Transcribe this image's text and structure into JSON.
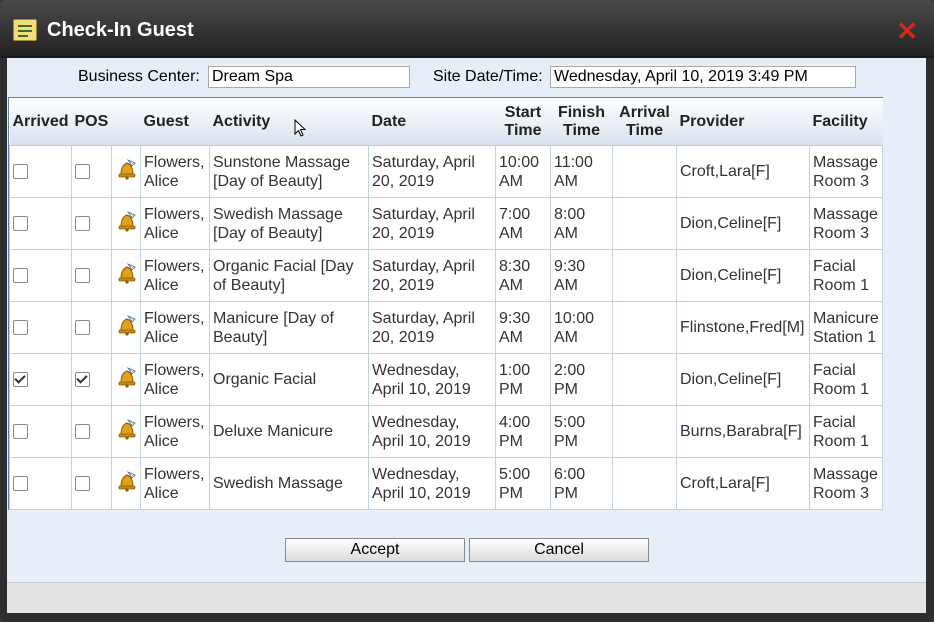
{
  "window": {
    "title": "Check-In Guest",
    "close_icon": "close-icon"
  },
  "form": {
    "business_center_label": "Business Center:",
    "business_center_value": "Dream Spa",
    "site_datetime_label": "Site Date/Time:",
    "site_datetime_value": "Wednesday, April 10, 2019 3:49 PM"
  },
  "table": {
    "headers": {
      "arrived": "Arrived",
      "pos": "POS",
      "guest": "Guest",
      "activity": "Activity",
      "date": "Date",
      "start_time": "Start Time",
      "finish_time": "Finish Time",
      "arrival_time": "Arrival Time",
      "provider": "Provider",
      "facility": "Facility"
    },
    "rows": [
      {
        "arrived": false,
        "pos": false,
        "guest": "Flowers, Alice",
        "activity": "Sunstone Massage [Day of Beauty]",
        "date": "Saturday, April 20, 2019",
        "start": "10:00 AM",
        "finish": "11:00 AM",
        "arrival": "",
        "provider": "Croft,Lara[F]",
        "facility": "Massage Room 3"
      },
      {
        "arrived": false,
        "pos": false,
        "guest": "Flowers, Alice",
        "activity": "Swedish Massage [Day of Beauty]",
        "date": "Saturday, April 20, 2019",
        "start": "7:00 AM",
        "finish": "8:00 AM",
        "arrival": "",
        "provider": "Dion,Celine[F]",
        "facility": "Massage Room 3"
      },
      {
        "arrived": false,
        "pos": false,
        "guest": "Flowers, Alice",
        "activity": "Organic Facial [Day of Beauty]",
        "date": "Saturday, April 20, 2019",
        "start": "8:30 AM",
        "finish": "9:30 AM",
        "arrival": "",
        "provider": "Dion,Celine[F]",
        "facility": "Facial Room 1"
      },
      {
        "arrived": false,
        "pos": false,
        "guest": "Flowers, Alice",
        "activity": "Manicure [Day of Beauty]",
        "date": "Saturday, April 20, 2019",
        "start": "9:30 AM",
        "finish": "10:00 AM",
        "arrival": "",
        "provider": "Flinstone,Fred[M]",
        "facility": "Manicure Station 1"
      },
      {
        "arrived": true,
        "pos": true,
        "guest": "Flowers, Alice",
        "activity": "Organic Facial",
        "date": "Wednesday, April 10, 2019",
        "start": "1:00 PM",
        "finish": "2:00 PM",
        "arrival": "",
        "provider": "Dion,Celine[F]",
        "facility": "Facial Room 1"
      },
      {
        "arrived": false,
        "pos": false,
        "guest": "Flowers, Alice",
        "activity": "Deluxe Manicure",
        "date": "Wednesday, April 10, 2019",
        "start": "4:00 PM",
        "finish": "5:00 PM",
        "arrival": "",
        "provider": "Burns,Barabra[F]",
        "facility": "Facial Room 1"
      },
      {
        "arrived": false,
        "pos": false,
        "guest": "Flowers, Alice",
        "activity": "Swedish Massage",
        "date": "Wednesday, April 10, 2019",
        "start": "5:00 PM",
        "finish": "6:00 PM",
        "arrival": "",
        "provider": "Croft,Lara[F]",
        "facility": "Massage Room 3"
      }
    ]
  },
  "buttons": {
    "accept": "Accept",
    "cancel": "Cancel"
  },
  "colors": {
    "accent": "#5b7fae",
    "close": "#d8261c"
  }
}
